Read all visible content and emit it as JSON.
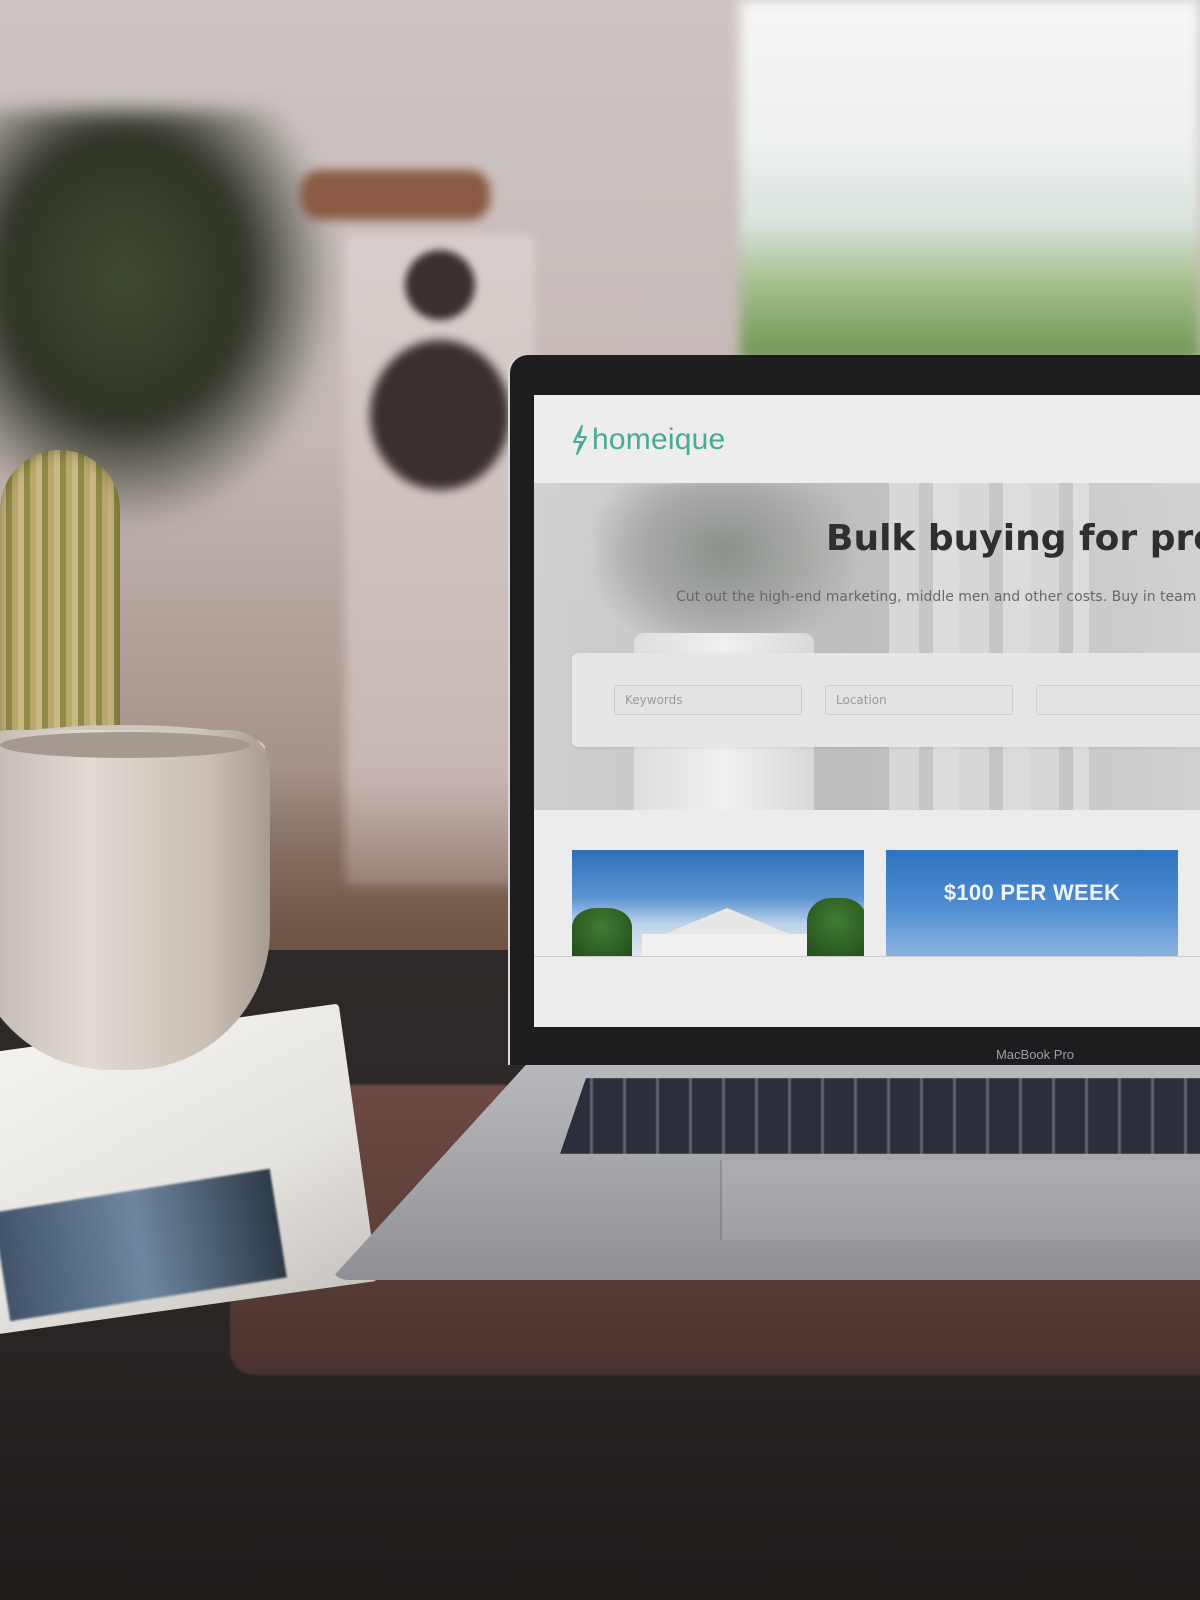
{
  "site": {
    "brand": "homeique",
    "brand_color": "#3fa792",
    "hero": {
      "title": "Bulk buying for proper",
      "subtitle": "Cut out the high-end marketing, middle men and other costs. Buy in team"
    },
    "search": {
      "keywords_placeholder": "Keywords",
      "location_placeholder": "Location",
      "third_placeholder": ""
    },
    "listings": [
      {
        "kind": "house-photo",
        "caption": ""
      },
      {
        "kind": "promo",
        "caption": "$100 PER WEEK"
      }
    ]
  },
  "device": {
    "label": "MacBook Pro"
  }
}
